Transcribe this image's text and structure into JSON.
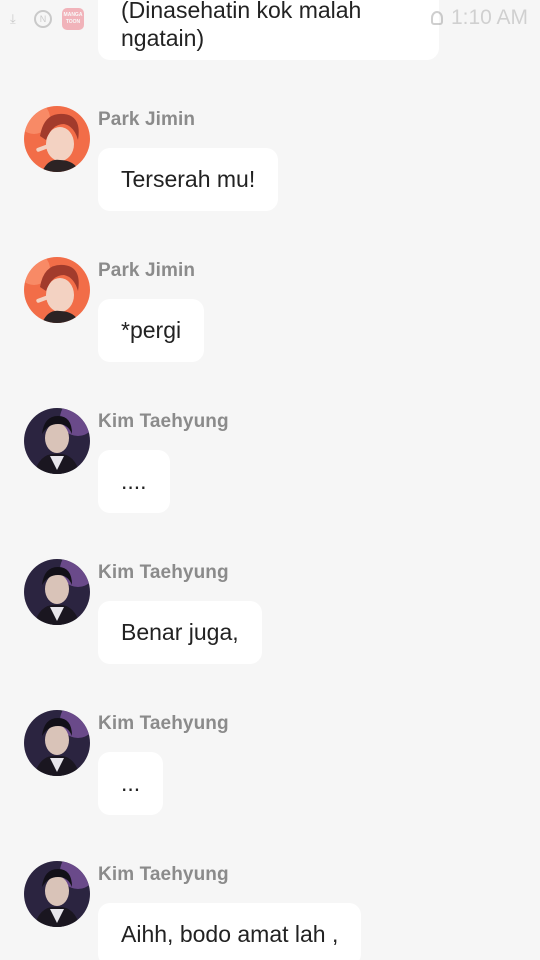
{
  "status_bar": {
    "app_icon_text": "MANGA TOON",
    "circle_icon_text": "N",
    "time": "1:10 AM"
  },
  "messages": [
    {
      "sender": "",
      "text": "(Dinasehatin kok malah ngatain)",
      "line1": "(Dinasehatin kok malah",
      "line2": "ngatain)"
    },
    {
      "sender": "Park Jimin",
      "text": "Terserah mu!"
    },
    {
      "sender": "Park Jimin",
      "text": "*pergi"
    },
    {
      "sender": "Kim Taehyung",
      "text": "...."
    },
    {
      "sender": "Kim Taehyung",
      "text": "Benar juga,"
    },
    {
      "sender": "Kim Taehyung",
      "text": "..."
    },
    {
      "sender": "Kim Taehyung",
      "text": "Aihh, bodo amat lah ,"
    }
  ],
  "colors": {
    "background": "#f6f6f6",
    "bubble": "#ffffff",
    "sender_name": "#8b8b8b",
    "message_text": "#222222",
    "jimin_avatar_bg": "#f0704a",
    "taehyung_avatar_bg": "#2a2440"
  },
  "icons": {
    "status_download": "download-icon",
    "status_app": "mangatoon-app-icon",
    "status_alarm": "alarm-icon"
  }
}
